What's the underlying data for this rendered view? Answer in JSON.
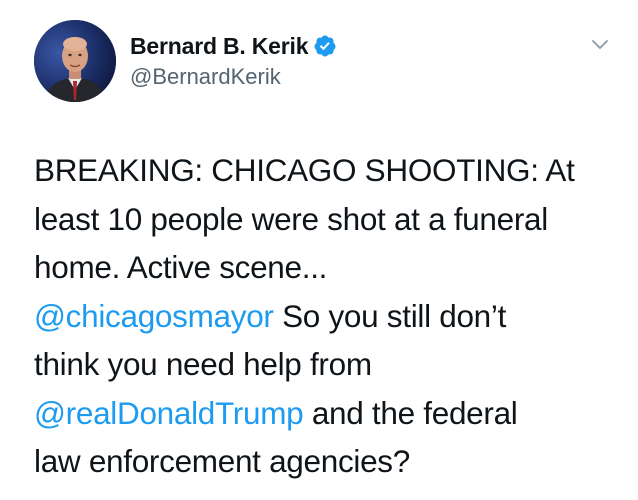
{
  "author": {
    "display_name": "Bernard B. Kerik",
    "handle": "@BernardKerik",
    "verified": true
  },
  "icons": {
    "verified": "verified-badge-icon",
    "menu": "chevron-down-icon"
  },
  "tweet": {
    "line1": "BREAKING: CHICAGO SHOOTING: At",
    "line2": "least 10 people were shot at a funeral",
    "line3": "home. Active scene...",
    "mention1": "@chicagosmayor",
    "line4_rest": " So you still don’t",
    "line5": "think you need help from",
    "mention2": "@realDonaldTrump",
    "line6_rest": " and the federal",
    "line7": "law enforcement agencies?"
  },
  "colors": {
    "text": "#0f1419",
    "secondary": "#536471",
    "link": "#1d9bf0",
    "verified": "#1d9bf0"
  }
}
